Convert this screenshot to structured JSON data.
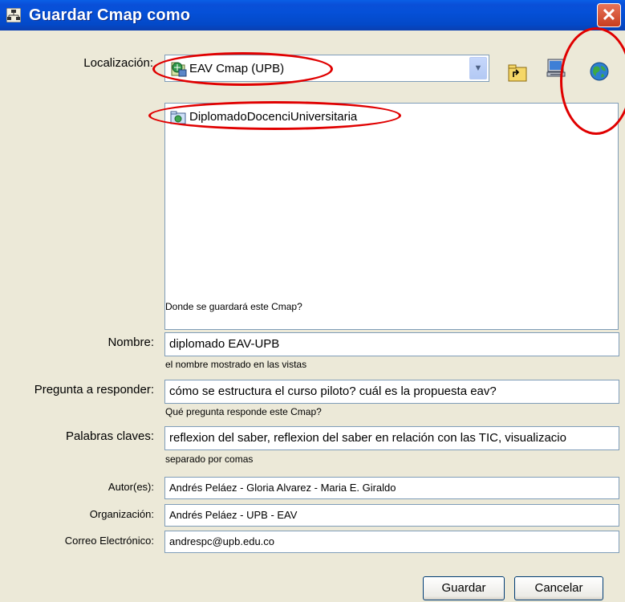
{
  "window": {
    "title": "Guardar Cmap como",
    "close_glyph": "✕"
  },
  "location": {
    "label": "Localización:",
    "selected": "EAV Cmap (UPB)",
    "hint": "Donde se guardará este Cmap?",
    "items": [
      {
        "label": "DiplomadoDocenciUniversitaria",
        "icon": "folder-icon"
      }
    ],
    "tool_icons": [
      "up-folder-icon",
      "computer-icon",
      "globe-icon"
    ]
  },
  "form": {
    "name": {
      "label": "Nombre:",
      "value": "diplomado EAV-UPB",
      "hint": "el nombre mostrado en las vistas"
    },
    "question": {
      "label": "Pregunta a responder:",
      "value": "cómo se estructura el curso piloto? cuál es la propuesta eav?",
      "hint": "Qué pregunta responde este Cmap?"
    },
    "keywords": {
      "label": "Palabras claves:",
      "value": "reflexion del saber, reflexion del saber en relación con las TIC, visualizacio",
      "hint": "separado por comas"
    },
    "authors": {
      "label": "Autor(es):",
      "value": "Andrés Peláez - Gloria Alvarez - Maria E. Giraldo"
    },
    "organization": {
      "label": "Organización:",
      "value": "Andrés Peláez - UPB - EAV"
    },
    "email": {
      "label": "Correo Electrónico:",
      "value": "andrespc@upb.edu.co"
    }
  },
  "buttons": {
    "save": "Guardar",
    "cancel": "Cancelar"
  },
  "colors": {
    "titlebar": "#0550d8",
    "annotation": "#e00000",
    "dialog_bg": "#ece9d8"
  }
}
